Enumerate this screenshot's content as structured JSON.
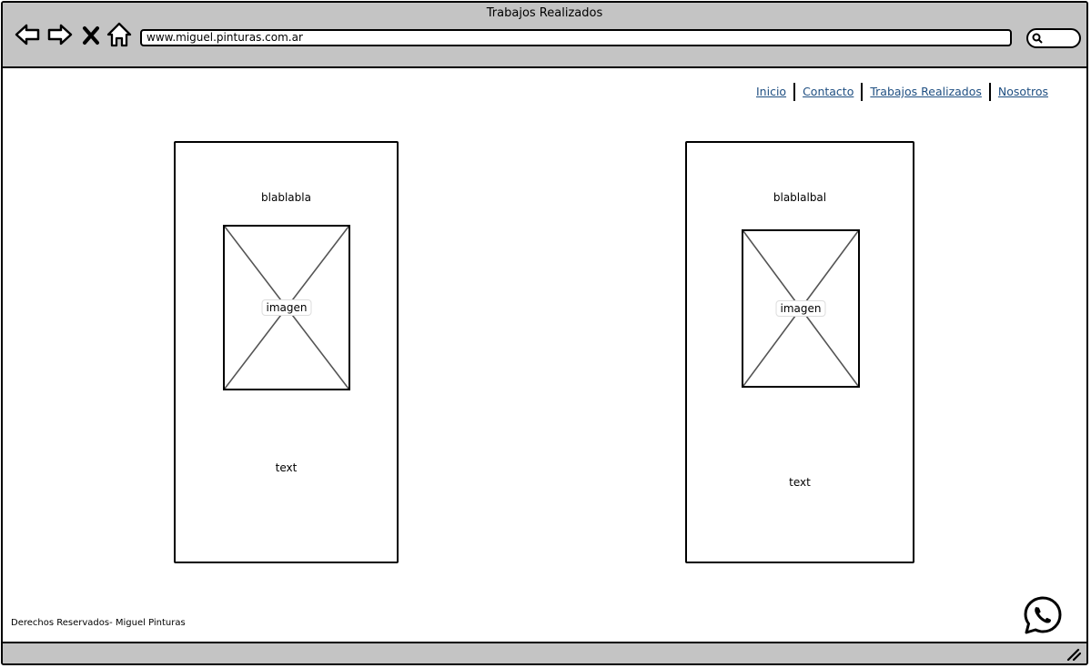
{
  "window": {
    "title": "Trabajos Realizados"
  },
  "toolbar": {
    "url": "www.miguel.pinturas.com.ar",
    "icons": [
      "back-arrow-icon",
      "forward-arrow-icon",
      "close-x-icon",
      "home-icon",
      "search-icon"
    ]
  },
  "nav": {
    "items": [
      {
        "label": "Inicio"
      },
      {
        "label": "Contacto"
      },
      {
        "label": "Trabajos Realizados"
      },
      {
        "label": "Nosotros"
      }
    ]
  },
  "cards": [
    {
      "title": "blablabla",
      "image_label": "imagen",
      "text": "text"
    },
    {
      "title": "blablalbal",
      "image_label": "imagen",
      "text": "text"
    }
  ],
  "footer": {
    "copyright": "Derechos Reservados- Miguel Pinturas",
    "whatsapp_icon": "whatsapp-icon"
  },
  "colors": {
    "chrome": "#c4c4c4",
    "link": "#1f4f82",
    "border": "#000000",
    "placeholder_x": "#555555"
  }
}
